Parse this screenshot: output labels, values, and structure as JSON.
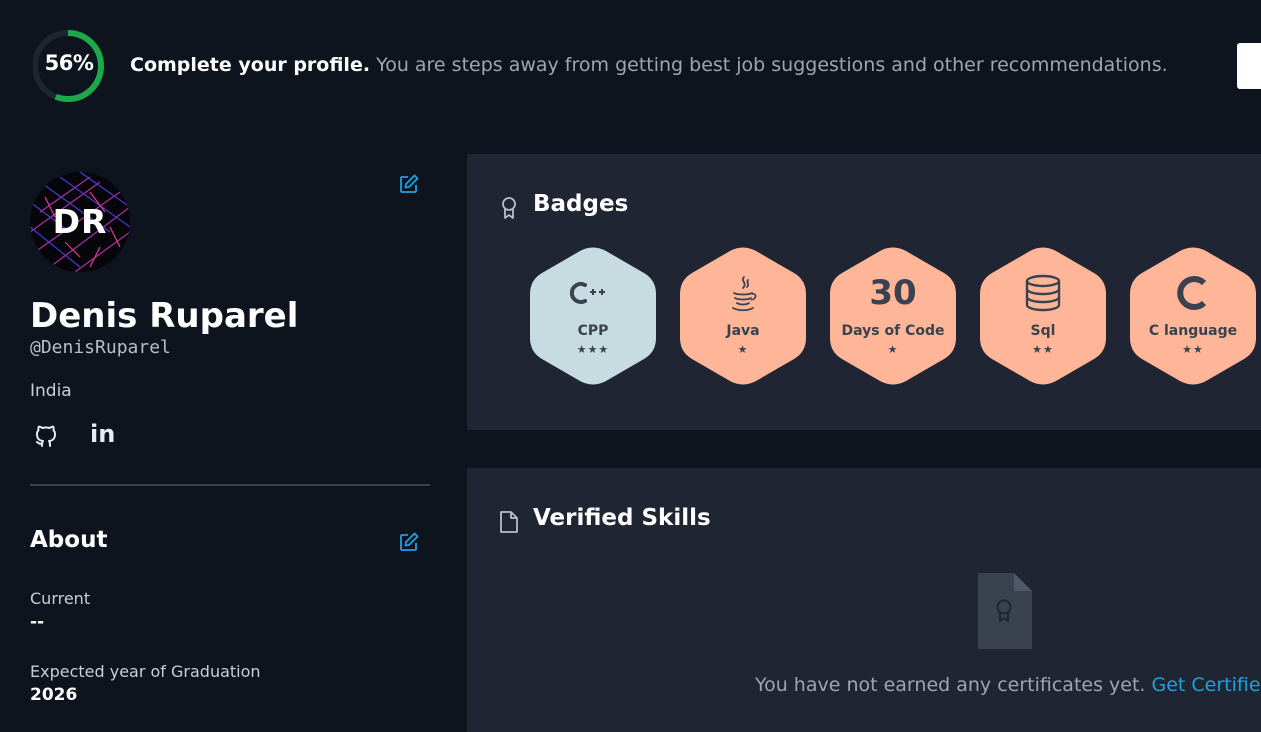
{
  "banner": {
    "progress_value": "56%",
    "progress_fraction": 0.56,
    "title": "Complete your profile.",
    "message": "You are steps away from getting best job suggestions and other recommendations.",
    "colors": {
      "progress": "#1ba94c",
      "track": "#39424e"
    }
  },
  "profile": {
    "initials": "DR",
    "name": "Denis Ruparel",
    "handle": "@DenisRuparel",
    "country": "India",
    "edit_icon": "edit-icon",
    "social": [
      {
        "icon": "github-icon"
      },
      {
        "icon": "linkedin-icon",
        "glyph": "in"
      }
    ]
  },
  "about": {
    "title": "About",
    "current_label": "Current",
    "current_value": "--",
    "grad_label": "Expected year of Graduation",
    "grad_value": "2026"
  },
  "badges": {
    "title": "Badges",
    "icon": "award-icon",
    "items": [
      {
        "name": "CPP",
        "stars": "★★★",
        "star_count": 3,
        "icon": "cpp-icon",
        "color": "#c6dce1"
      },
      {
        "name": "Java",
        "stars": "★",
        "star_count": 1,
        "icon": "java-icon",
        "color": "#ffb598"
      },
      {
        "name": "Days of Code",
        "number": "30",
        "stars": "★",
        "star_count": 1,
        "color": "#ffb598"
      },
      {
        "name": "Sql",
        "stars": "★★",
        "star_count": 2,
        "icon": "database-icon",
        "color": "#ffb598"
      },
      {
        "name": "C language",
        "stars": "★★",
        "star_count": 2,
        "icon": "c-language-icon",
        "color": "#ffb598"
      }
    ]
  },
  "skills": {
    "title": "Verified Skills",
    "icon": "document-icon",
    "empty_message": "You have not earned any certificates yet.",
    "cta": "Get Certified"
  }
}
